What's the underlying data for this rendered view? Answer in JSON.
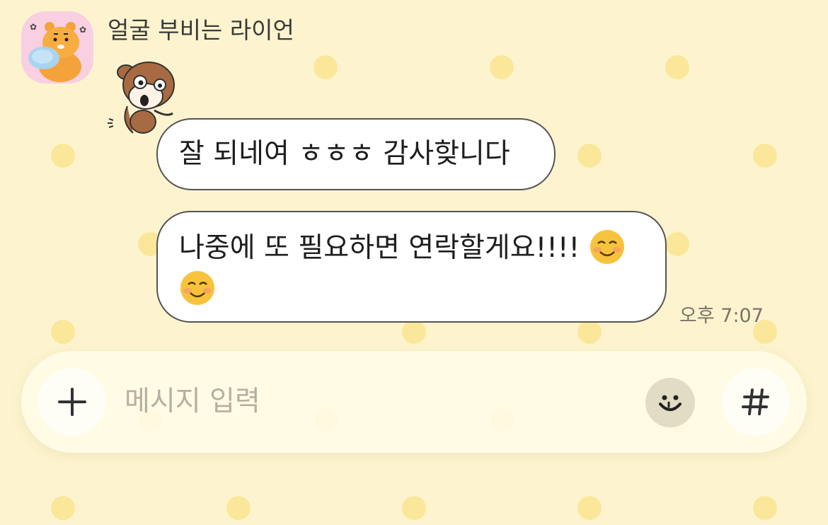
{
  "chat": {
    "sender_name": "얼굴 부비는 라이언",
    "messages": [
      {
        "text": "잘 되네여 ㅎㅎㅎ 감사핮니다"
      },
      {
        "text": "나중에 또 필요하면 연락할게요!!!!"
      }
    ],
    "timestamp": "오후 7:07"
  },
  "composer": {
    "placeholder": "메시지 입력",
    "value": ""
  },
  "icons": {
    "attach": "plus-icon",
    "emoticon": "smiley-icon",
    "hashtag": "hashtag-icon",
    "message_emoji": "smiling-face-emoji"
  },
  "colors": {
    "background": "#fdf4cf",
    "dot_pattern": "#fbe79a",
    "bubble": "#ffffff",
    "bubble_border": "#555555",
    "avatar_bg": "#f9cfe2"
  }
}
